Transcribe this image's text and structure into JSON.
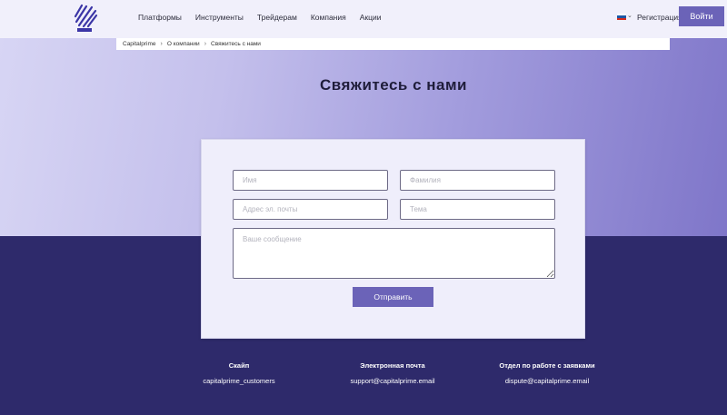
{
  "header": {
    "nav": [
      "Платформы",
      "Инструменты",
      "Трейдерам",
      "Компания",
      "Акции"
    ],
    "register_label": "Регистрация",
    "login_label": "Войти",
    "flag_colors": [
      "#ffffff",
      "#1c57a5",
      "#d52b1e"
    ]
  },
  "breadcrumb": {
    "items": [
      "Capitalprime",
      "О компании"
    ],
    "current": "Свяжитесь с нами"
  },
  "page_title": "Свяжитесь с нами",
  "form": {
    "first_name_placeholder": "Имя",
    "last_name_placeholder": "Фамилия",
    "email_placeholder": "Адрес эл. почты",
    "subject_placeholder": "Тема",
    "message_placeholder": "Ваше сообщение",
    "submit_label": "Отправить"
  },
  "contacts": [
    {
      "title": "Скайп",
      "value": "capitalprime_customers"
    },
    {
      "title": "Электронная почта",
      "value": "support@capitalprime.email"
    },
    {
      "title": "Отдел по работе с заявками",
      "value": "dispute@capitalprime.email"
    }
  ],
  "colors": {
    "accent": "#6b63b8",
    "footer_bg": "#2e2a6b",
    "header_bg": "#f1f0fb"
  }
}
